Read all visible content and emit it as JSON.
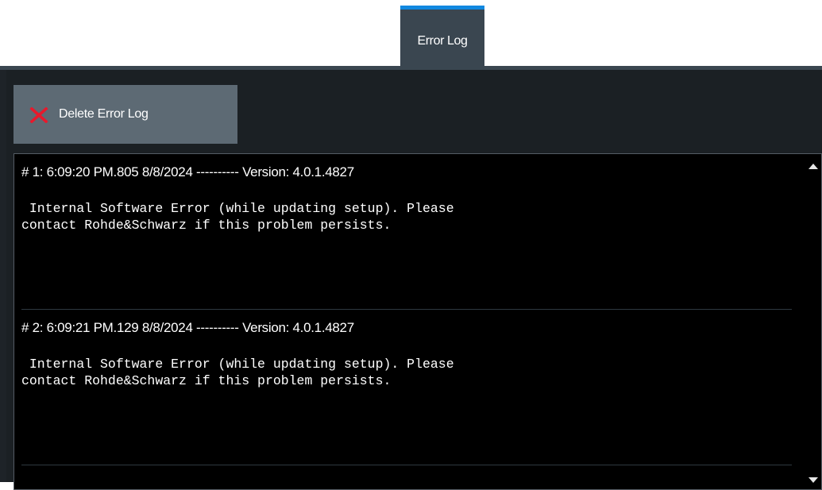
{
  "tab": {
    "label": "Error Log"
  },
  "toolbar": {
    "delete_label": "Delete Error Log",
    "delete_icon": "close-icon",
    "delete_icon_color": "#e8192c"
  },
  "log": {
    "entries": [
      {
        "header": "# 1: 6:09:20 PM.805 8/8/2024 ---------- Version: 4.0.1.4827",
        "message": " Internal Software Error (while updating setup). Please\ncontact Rohde&Schwarz if this problem persists."
      },
      {
        "header": "# 2: 6:09:21 PM.129 8/8/2024 ---------- Version: 4.0.1.4827",
        "message": " Internal Software Error (while updating setup). Please\ncontact Rohde&Schwarz if this problem persists."
      }
    ]
  },
  "colors": {
    "accent": "#1188e0",
    "tab_bg": "#3a4650",
    "button_bg": "#5d6a74",
    "log_bg": "#000000"
  }
}
